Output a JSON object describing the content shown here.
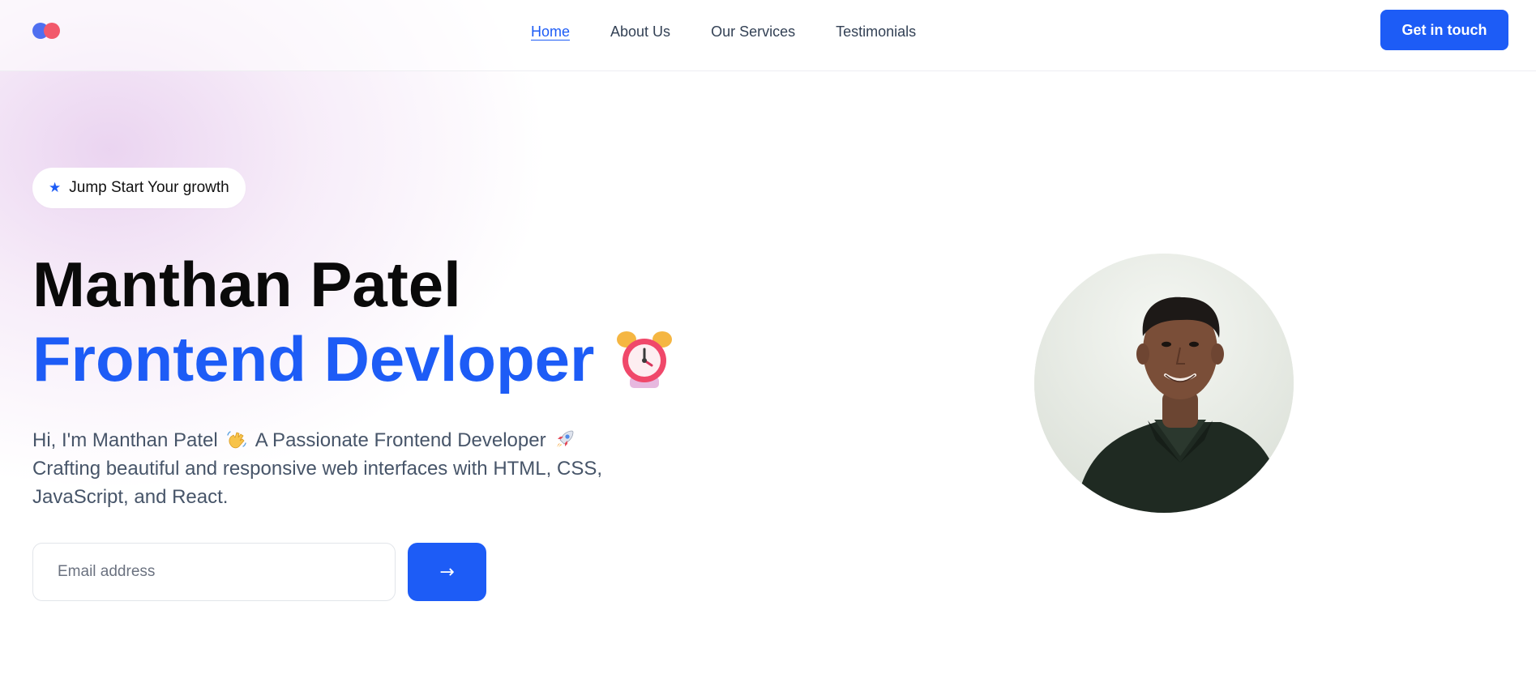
{
  "header": {
    "logo_icon": "logo-two-dots-icon",
    "nav": [
      {
        "label": "Home",
        "active": true
      },
      {
        "label": "About Us",
        "active": false
      },
      {
        "label": "Our Services",
        "active": false
      },
      {
        "label": "Testimonials",
        "active": false
      }
    ],
    "cta_label": "Get in touch"
  },
  "hero": {
    "badge_icon": "star-icon",
    "badge_text": "Jump Start Your growth",
    "name": "Manthan Patel",
    "role": "Frontend Devloper",
    "role_icon": "alarm-clock-icon",
    "description_line1_a": "Hi, I'm Manthan Patel",
    "description_line1_icon1": "waving-hand-icon",
    "description_line1_b": "A Passionate Frontend Developer",
    "description_line1_icon2": "rocket-icon",
    "description_line2": "Crafting beautiful and responsive web interfaces with HTML, CSS,",
    "description_line3": "JavaScript, and React.",
    "email_placeholder": "Email address",
    "email_value": "",
    "submit_label": "→",
    "avatar_icon": "profile-photo"
  },
  "colors": {
    "accent": "#1d5cf6",
    "heading": "#0a0a0a",
    "body_text": "#475569",
    "logo_blue": "#4f6ff0",
    "logo_red": "#f2596b"
  }
}
